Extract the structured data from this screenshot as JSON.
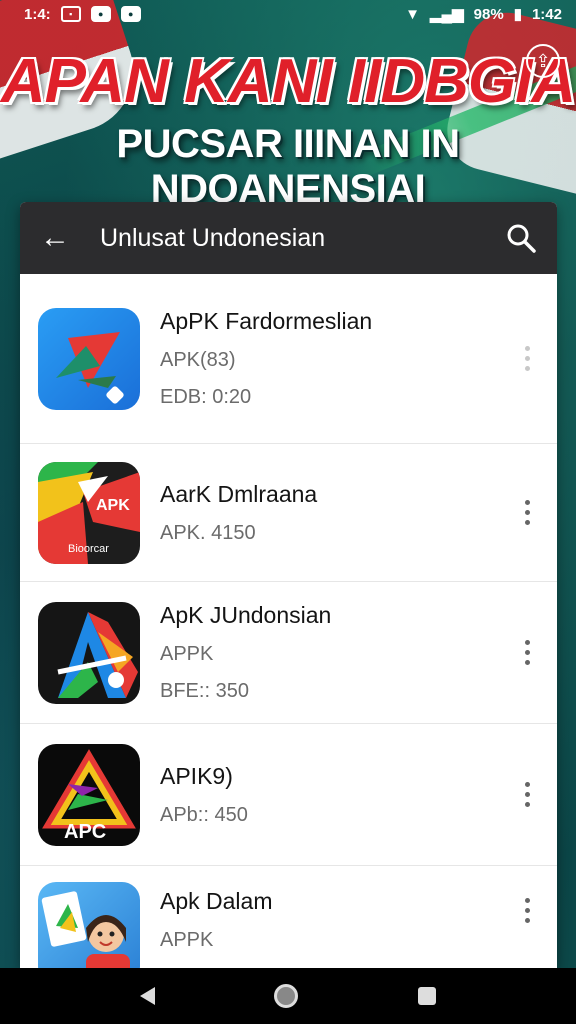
{
  "status_bar": {
    "time_left": "1:4:",
    "battery": "98%",
    "time_right": "1:42"
  },
  "banner": {
    "line1": "APAN KANI IIDBGIA",
    "line2": "PUCSAR IIINAN IN NDOANENSIAI"
  },
  "app_bar": {
    "title": "Unlusat Undonesian"
  },
  "apps": [
    {
      "name": "ApPK Fardormeslian",
      "sub": "APK(83)",
      "meta": "EDB: 0:20"
    },
    {
      "name": "AarK Dmlraana",
      "sub": "APK. 4150",
      "meta": ""
    },
    {
      "name": "ApK JUndonsian",
      "sub": "APPK",
      "meta": "BFE:: 350"
    },
    {
      "name": "APIK9)",
      "sub": "APb:: 450",
      "meta": ""
    },
    {
      "name": "Apk Dalam",
      "sub": "APPK",
      "meta": ""
    }
  ],
  "icon_texts": {
    "app2_badge": "APK",
    "app2_caption": "Bioorcar",
    "app4_label": "APC"
  },
  "colors": {
    "banner_red": "#e0202a",
    "app_bar_bg": "#2c2c2e",
    "flag_red": "#d3262c"
  }
}
